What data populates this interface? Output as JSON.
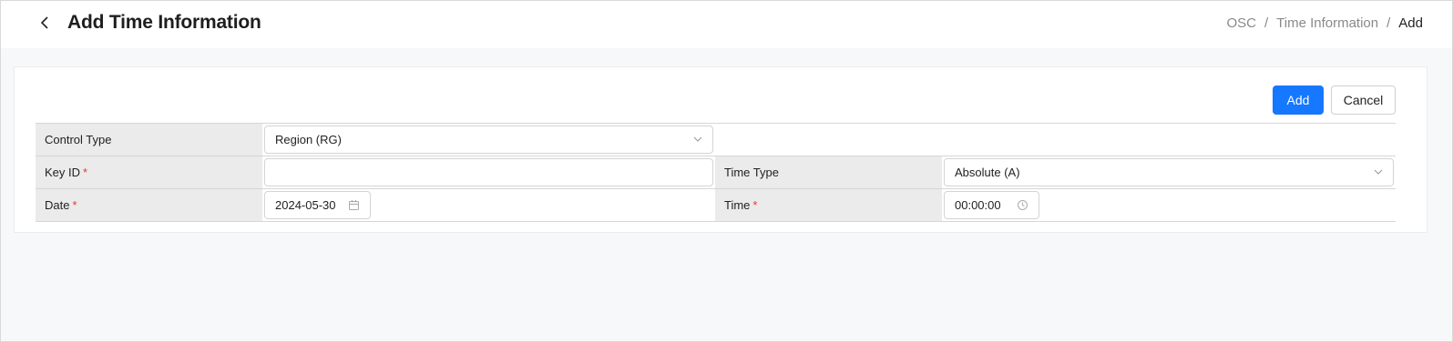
{
  "header": {
    "title": "Add Time Information",
    "breadcrumb": [
      "OSC",
      "Time Information",
      "Add"
    ]
  },
  "actions": {
    "add_label": "Add",
    "cancel_label": "Cancel",
    "accent_color": "#1677ff"
  },
  "form": {
    "control_type": {
      "label": "Control Type",
      "value": "Region (RG)"
    },
    "key_id": {
      "label": "Key ID",
      "required_mark": "*",
      "value": ""
    },
    "time_type": {
      "label": "Time Type",
      "value": "Absolute (A)"
    },
    "date": {
      "label": "Date",
      "required_mark": "*",
      "value": "2024-05-30"
    },
    "time": {
      "label": "Time",
      "required_mark": "*",
      "value": "00:00:00"
    }
  },
  "icons": {
    "back": "chevron-left-icon",
    "select": "chevron-down-icon",
    "date": "calendar-icon",
    "time": "clock-icon"
  },
  "colors": {
    "required": "#e53935",
    "label_bg": "#ebebeb",
    "page_bg": "#f7f8f9"
  }
}
